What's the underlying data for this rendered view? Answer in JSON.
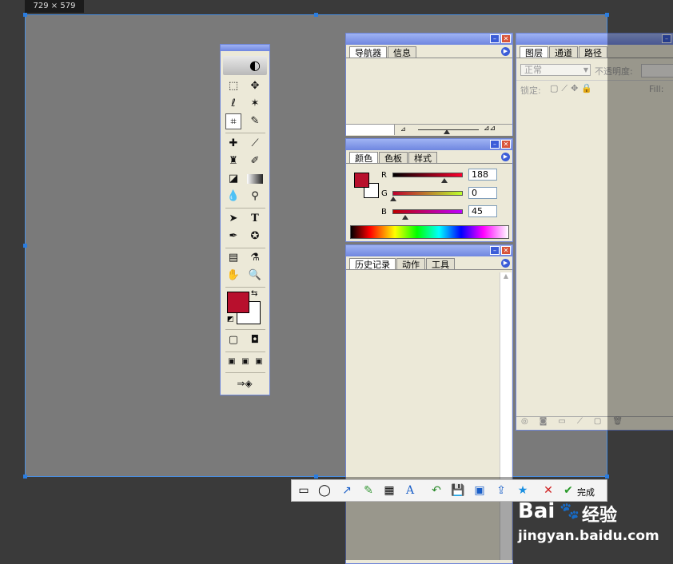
{
  "selection": {
    "dimensions": "729 × 579"
  },
  "colors": {
    "foreground": "#b8102d",
    "background": "#ffffff",
    "accent": "#4a8ee0",
    "palette_border": "#6f86d8"
  },
  "navigator_panel": {
    "tabs": [
      "导航器",
      "信息"
    ],
    "active_tab": 0
  },
  "color_panel": {
    "tabs": [
      "颜色",
      "色板",
      "样式"
    ],
    "active_tab": 0,
    "channels": [
      {
        "label": "R",
        "value": "188"
      },
      {
        "label": "G",
        "value": "0"
      },
      {
        "label": "B",
        "value": "45"
      }
    ]
  },
  "history_panel": {
    "tabs": [
      "历史记录",
      "动作",
      "工具"
    ],
    "active_tab": 0
  },
  "layers_panel": {
    "tabs": [
      "图层",
      "通道",
      "路径"
    ],
    "active_tab": 0,
    "blend_mode": "正常",
    "opacity_label": "不透明度:",
    "lock_label": "锁定:",
    "fill_label": "Fill:"
  },
  "capture_toolbar": {
    "done_label": "完成",
    "icons": [
      "rectangle-icon",
      "ellipse-icon",
      "arrow-icon",
      "brush-icon",
      "mosaic-icon",
      "text-icon",
      "undo-icon",
      "save-icon",
      "copy-icon",
      "share-icon",
      "pin-icon",
      "cancel-icon",
      "done-icon"
    ]
  },
  "watermark": {
    "brand": "Bai",
    "brand_suffix": "经验",
    "url": "jingyan.baidu.com"
  }
}
